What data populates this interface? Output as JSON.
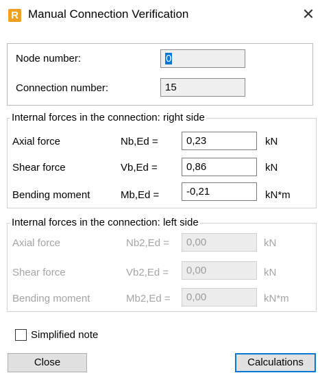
{
  "window": {
    "title": "Manual Connection Verification",
    "app_icon_letter": "R",
    "close_glyph": "✕"
  },
  "identification": {
    "node_label": "Node number:",
    "node_value": "0",
    "connection_label": "Connection number:",
    "connection_value": "15"
  },
  "right_side": {
    "title": "Internal forces in the connection: right side",
    "rows": [
      {
        "label": "Axial force",
        "symbol": "Nb,Ed =",
        "value": "0,23",
        "unit": "kN"
      },
      {
        "label": "Shear force",
        "symbol": "Vb,Ed =",
        "value": "0,86",
        "unit": "kN"
      },
      {
        "label": "Bending moment",
        "symbol": "Mb,Ed =",
        "value": "-0,21",
        "unit": "kN*m"
      }
    ]
  },
  "left_side": {
    "title": "Internal forces in the connection: left side",
    "rows": [
      {
        "label": "Axial force",
        "symbol": "Nb2,Ed =",
        "value": "0,00",
        "unit": "kN"
      },
      {
        "label": "Shear force",
        "symbol": "Vb2,Ed =",
        "value": "0,00",
        "unit": "kN"
      },
      {
        "label": "Bending moment",
        "symbol": "Mb2,Ed =",
        "value": "0,00",
        "unit": "kN*m"
      }
    ]
  },
  "options": {
    "simplified_note_label": "Simplified note",
    "simplified_note_checked": false
  },
  "buttons": {
    "close_label": "Close",
    "calculations_label": "Calculations"
  },
  "colors": {
    "accent": "#0078d7",
    "icon": "#f0a020",
    "disabled_text": "#a4a4a4"
  }
}
